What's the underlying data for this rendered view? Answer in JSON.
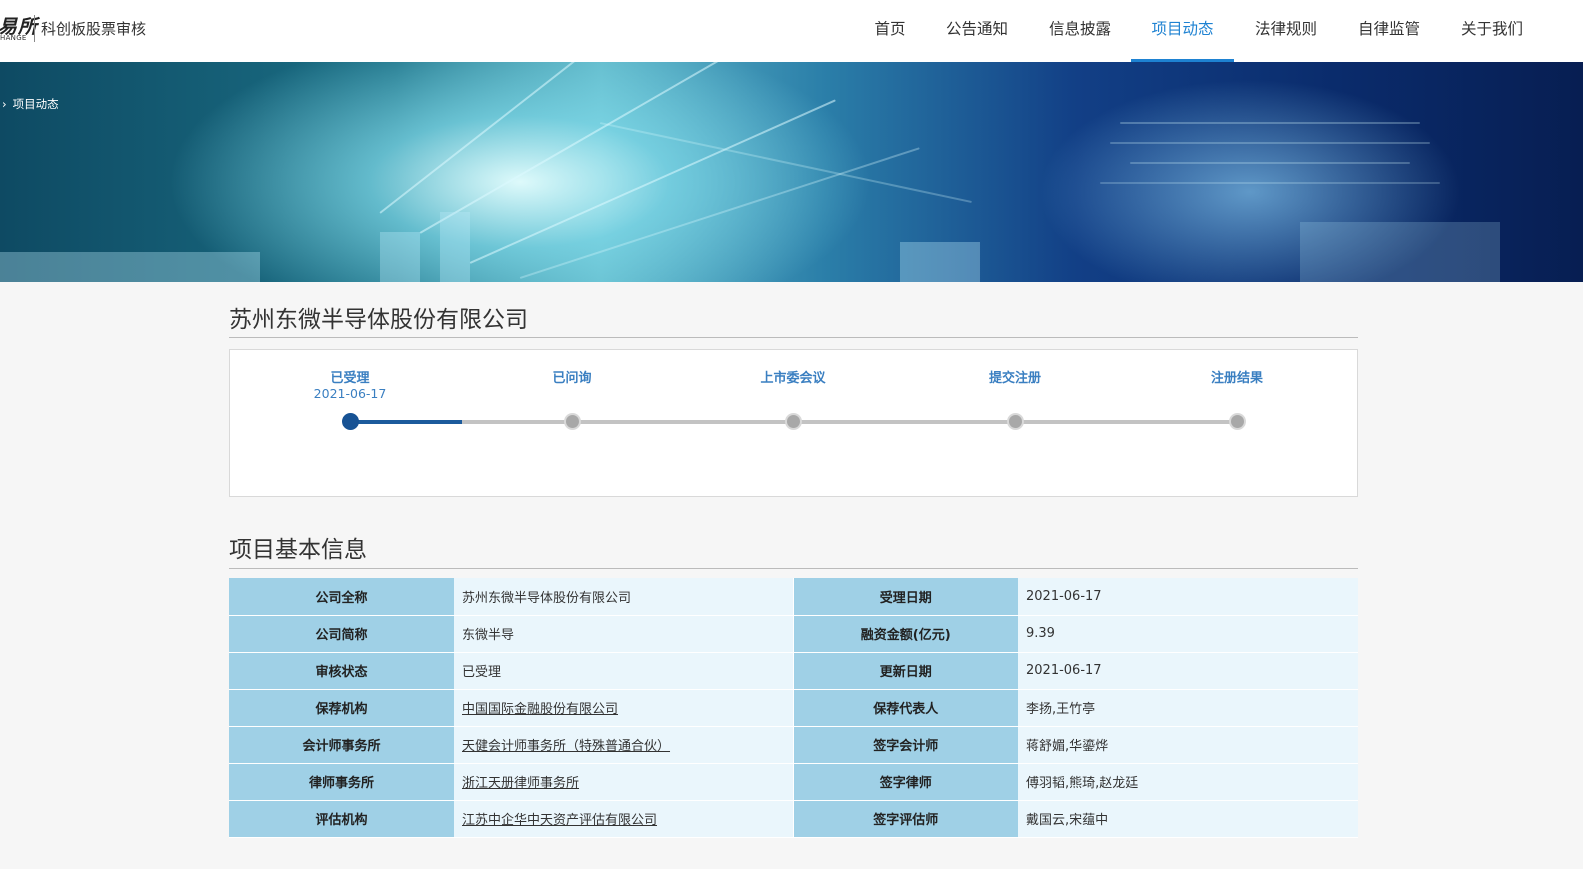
{
  "header": {
    "logo_cn": "易所",
    "logo_en": "HANGE",
    "subtitle": "科创板股票审核"
  },
  "nav": [
    {
      "label": "首页"
    },
    {
      "label": "公告通知"
    },
    {
      "label": "信息披露"
    },
    {
      "label": "项目动态",
      "active": true
    },
    {
      "label": "法律规则"
    },
    {
      "label": "自律监管"
    },
    {
      "label": "关于我们"
    }
  ],
  "breadcrumb": "项目动态",
  "company": {
    "title": "苏州东微半导体股份有限公司"
  },
  "progress": {
    "steps": [
      {
        "label": "已受理",
        "date": "2021-06-17",
        "active": true
      },
      {
        "label": "已问询",
        "date": ""
      },
      {
        "label": "上市委会议",
        "date": ""
      },
      {
        "label": "提交注册",
        "date": ""
      },
      {
        "label": "注册结果",
        "date": ""
      }
    ]
  },
  "section": {
    "title": "项目基本信息"
  },
  "info": {
    "rows": [
      {
        "k1": "公司全称",
        "v1": "苏州东微半导体股份有限公司",
        "k2": "受理日期",
        "v2": "2021-06-17"
      },
      {
        "k1": "公司简称",
        "v1": "东微半导",
        "k2": "融资金额(亿元)",
        "v2": "9.39"
      },
      {
        "k1": "审核状态",
        "v1": "已受理",
        "k2": "更新日期",
        "v2": "2021-06-17"
      },
      {
        "k1": "保荐机构",
        "v1": "中国国际金融股份有限公司",
        "k2": "保荐代表人",
        "v2": "李扬,王竹亭"
      },
      {
        "k1": "会计师事务所",
        "v1": "天健会计师事务所（特殊普通合伙）",
        "k2": "签字会计师",
        "v2": "蒋舒媚,华鎏烨"
      },
      {
        "k1": "律师事务所",
        "v1": "浙江天册律师事务所",
        "k2": "签字律师",
        "v2": "傅羽韬,熊琦,赵龙廷"
      },
      {
        "k1": "评估机构",
        "v1": "江苏中企华中天资产评估有限公司",
        "k2": "签字评估师",
        "v2": "戴国云,宋蕴中"
      }
    ]
  }
}
